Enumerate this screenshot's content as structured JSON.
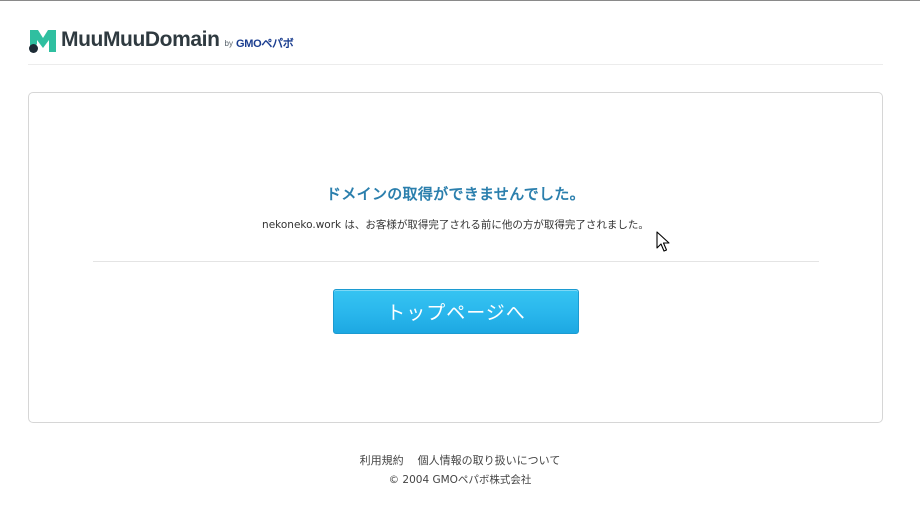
{
  "header": {
    "logo_text": "MuuMuuDomain",
    "logo_by": "by",
    "logo_gmo": "GMOペパボ",
    "logo_mark_colors": [
      "#2fbfa0",
      "#1d2b36"
    ]
  },
  "error": {
    "title": "ドメインの取得ができませんでした。",
    "message": "nekoneko.work は、お客様が取得完了される前に他の方が取得完了されました。"
  },
  "button": {
    "label": "トップページへ",
    "color": "#29b6ec"
  },
  "footer": {
    "links": [
      "利用規約",
      "個人情報の取り扱いについて"
    ],
    "copyright": "© 2004 GMOペパボ株式会社"
  }
}
